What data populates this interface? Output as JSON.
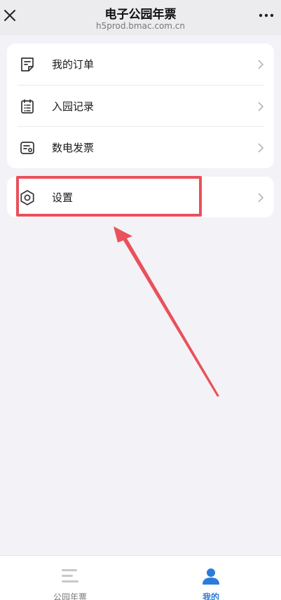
{
  "header": {
    "title": "电子公园年票",
    "subtitle": "h5prod.bmac.com.cn",
    "close_icon": "close-icon",
    "more_icon": "more-icon"
  },
  "menu": {
    "items": [
      {
        "label": "我的订单",
        "icon": "order-list-icon"
      },
      {
        "label": "入园记录",
        "icon": "entry-record-icon"
      },
      {
        "label": "数电发票",
        "icon": "invoice-icon"
      }
    ]
  },
  "settings": {
    "label": "设置",
    "icon": "hexagon-settings-icon"
  },
  "tabbar": {
    "tabs": [
      {
        "label": "公园年票",
        "icon": "list-icon",
        "active": false
      },
      {
        "label": "我的",
        "icon": "person-icon",
        "active": true
      }
    ],
    "active_color": "#2b7bd9",
    "inactive_color": "#7a7a7a"
  },
  "annotation": {
    "highlight_color": "#e9515b"
  }
}
